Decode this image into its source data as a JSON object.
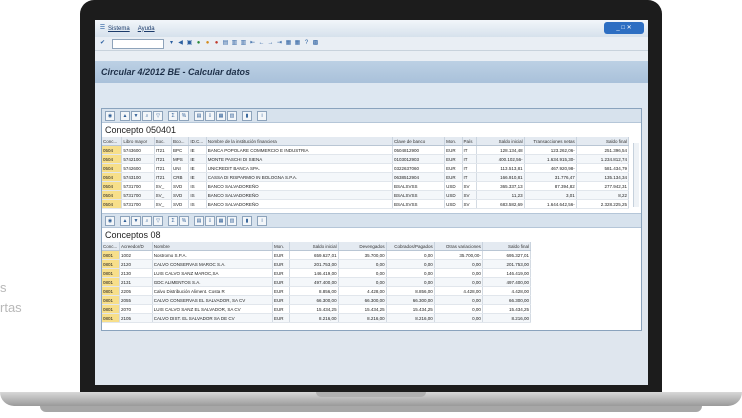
{
  "side_text": [
    "s",
    "rtas"
  ],
  "window": {
    "menu": [
      "Sistema",
      "Ayuda"
    ],
    "controls": "_ □ ✕"
  },
  "app_title": "Circular 4/2012 BE - Calcular datos",
  "panel1": {
    "title": "Concepto 050401",
    "columns": [
      "Conc...",
      "Libro mayor",
      "Soc.",
      "Bco...",
      "ID.C...",
      "Nombre de la institución financiera",
      "Clave de banco",
      "Mon.",
      "País",
      "Saldo inicial",
      "Transacciones netas",
      "Saldo final"
    ],
    "rows": [
      [
        "0504",
        "5743600",
        "IT21",
        "BPC",
        "IE",
        "BANCA POPOLARE COMMERCIO E INDUSTRIA",
        "0504812900",
        "EUR",
        "IT",
        "128.134,48",
        "123.262,06-",
        "251.396,54"
      ],
      [
        "0504",
        "5742100",
        "IT21",
        "MPS",
        "IE",
        "MONTE PASCHI DI SIENA",
        "0103012903",
        "EUR",
        "IT",
        "400.102,56-",
        "1.634.915,30-",
        "1.234.812,74"
      ],
      [
        "0504",
        "5742600",
        "IT21",
        "UNI",
        "IE",
        "UNICREDIT BANCA SPA.",
        "0322637060",
        "EUR",
        "IT",
        "113.513,81",
        "467.920,98-",
        "581.434,79"
      ],
      [
        "0504",
        "5743100",
        "IT21",
        "CRB",
        "IE",
        "CASSA DI RISPARMIO IN BOLOGNA S.P.A.",
        "0638512904",
        "EUR",
        "IT",
        "166.910,81",
        "31.776,47",
        "135.134,34"
      ],
      [
        "0504",
        "5731700",
        "SV_",
        "SVD",
        "IS",
        "BANCO SALVADOREÑO",
        "BSALSVSS",
        "USD",
        "SV",
        "365.337,13",
        "87.394,82",
        "277.942,31"
      ],
      [
        "0504",
        "5731700",
        "SV_",
        "SVD",
        "IS",
        "BANCO SALVADOREÑO",
        "BSALSVSS",
        "USD",
        "SV",
        "11,23",
        "3,01",
        "8,22"
      ],
      [
        "0504",
        "5731700",
        "SV_",
        "SVD",
        "IS",
        "BANCO SALVADOREÑO",
        "BSALSVSS",
        "USD",
        "SV",
        "683.582,69",
        "1.644.642,56-",
        "2.328.225,25"
      ]
    ]
  },
  "panel2": {
    "title": "Conceptos 08",
    "columns": [
      "Conc...",
      "Acreedor/D",
      "Nombre",
      "Mon.",
      "Saldo inicial",
      "Devengados",
      "Cobrados/Pagados",
      "Otras variaciones",
      "Saldo final"
    ],
    "rows": [
      [
        "0801",
        "1002",
        "Nostromo S.P.A.",
        "EUR",
        "659.627,01",
        "35.700,00",
        "0,00",
        "35.700,00-",
        "695.327,01"
      ],
      [
        "0801",
        "2120",
        "CALVO CONSERVAS MAROC S.A.",
        "EUR",
        "201.753,00",
        "0,00",
        "0,00",
        "0,00",
        "201.753,00"
      ],
      [
        "0801",
        "2130",
        "LUIS CALVO SANZ MAROC,SA",
        "EUR",
        "146.419,00",
        "0,00",
        "0,00",
        "0,00",
        "146.419,00"
      ],
      [
        "0801",
        "2131",
        "GDC ALIMENTOS S.A.",
        "EUR",
        "497.400,00",
        "0,00",
        "0,00",
        "0,00",
        "497.400,00"
      ],
      [
        "0801",
        "2205",
        "Calvo Distribución Aliment. Costa R",
        "EUR",
        "8.856,00",
        "4.428,00",
        "8.856,00",
        "4.428,00",
        "4.428,00"
      ],
      [
        "0801",
        "2055",
        "CALVO CONSERVAS EL SALVADOR, SA CV",
        "EUR",
        "66.300,00",
        "66.300,00",
        "66.300,00",
        "0,00",
        "66.300,00"
      ],
      [
        "0801",
        "2070",
        "LUIS CALVO SANZ EL SALVADOR, SA CV",
        "EUR",
        "15.434,25",
        "15.434,25",
        "15.434,25",
        "0,00",
        "15.434,25"
      ],
      [
        "0801",
        "2105",
        "CALVO DIST. EL SALVADOR SA DE CV",
        "EUR",
        "8.216,00",
        "8.216,00",
        "8.216,00",
        "0,00",
        "8.216,00"
      ]
    ]
  }
}
